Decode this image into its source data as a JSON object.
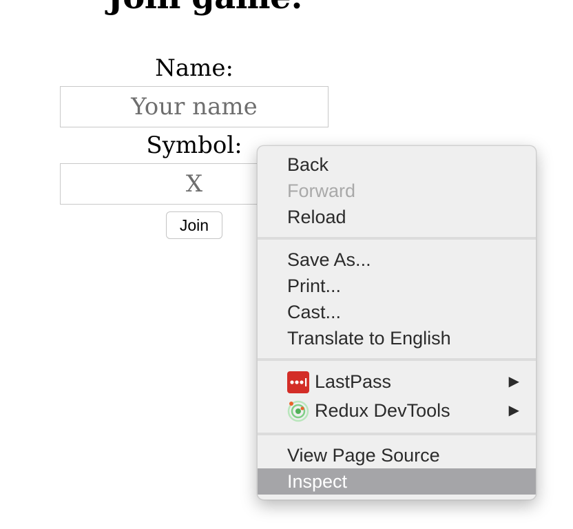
{
  "page": {
    "title": "Join game:",
    "name_label": "Name:",
    "name_placeholder": "Your name",
    "symbol_label": "Symbol:",
    "symbol_placeholder": "X",
    "join_label": "Join"
  },
  "context_menu": {
    "items": [
      {
        "label": "Back",
        "enabled": true
      },
      {
        "label": "Forward",
        "enabled": false
      },
      {
        "label": "Reload",
        "enabled": true
      },
      {
        "label": "Save As...",
        "enabled": true
      },
      {
        "label": "Print...",
        "enabled": true
      },
      {
        "label": "Cast...",
        "enabled": true
      },
      {
        "label": "Translate to English",
        "enabled": true
      },
      {
        "label": "LastPass",
        "enabled": true,
        "icon": "lastpass-icon",
        "submenu": true
      },
      {
        "label": "Redux DevTools",
        "enabled": true,
        "icon": "redux-devtools-icon",
        "submenu": true
      },
      {
        "label": "View Page Source",
        "enabled": true
      },
      {
        "label": "Inspect",
        "enabled": true,
        "highlighted": true
      }
    ],
    "submenu_arrow": "▶"
  },
  "colors": {
    "menu_background": "#efefef",
    "menu_highlight": "#a5a5a8",
    "lastpass_red": "#d32d27",
    "redux_green": "#52b05a",
    "redux_orange": "#e8632b"
  }
}
